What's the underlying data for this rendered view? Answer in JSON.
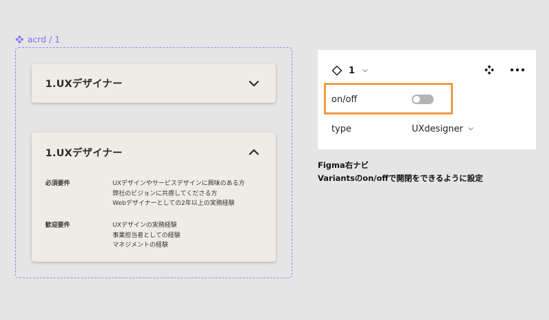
{
  "component_set": {
    "name": "acrd / 1",
    "accent_color": "#8b6cf6"
  },
  "cards": {
    "closed": {
      "title": "1.UXデザイナー",
      "chevron": "chevron-down-icon"
    },
    "open": {
      "title": "1.UXデザイナー",
      "chevron": "chevron-up-icon",
      "sections": [
        {
          "label": "必須要件",
          "lines": [
            "UXデザインやサービスデザインに興味のある方",
            "弊社のビジョンに共感してくださる方",
            "Webデザイナーとしての2年以上の実務経験"
          ]
        },
        {
          "label": "歓迎要件",
          "lines": [
            "UXデザインの実務経験",
            "事業担当者としての経験",
            "マネジメントの経験"
          ]
        }
      ]
    }
  },
  "panel": {
    "instance_label": "1",
    "properties": [
      {
        "name": "on/off",
        "control": "toggle",
        "state": "off"
      },
      {
        "name": "type",
        "value": "UXdesigner"
      }
    ],
    "highlight_color": "#ef9a45"
  },
  "caption": {
    "line1": "Figma右ナビ",
    "line2": "Variantsのon/offで開閉をできるように設定"
  }
}
